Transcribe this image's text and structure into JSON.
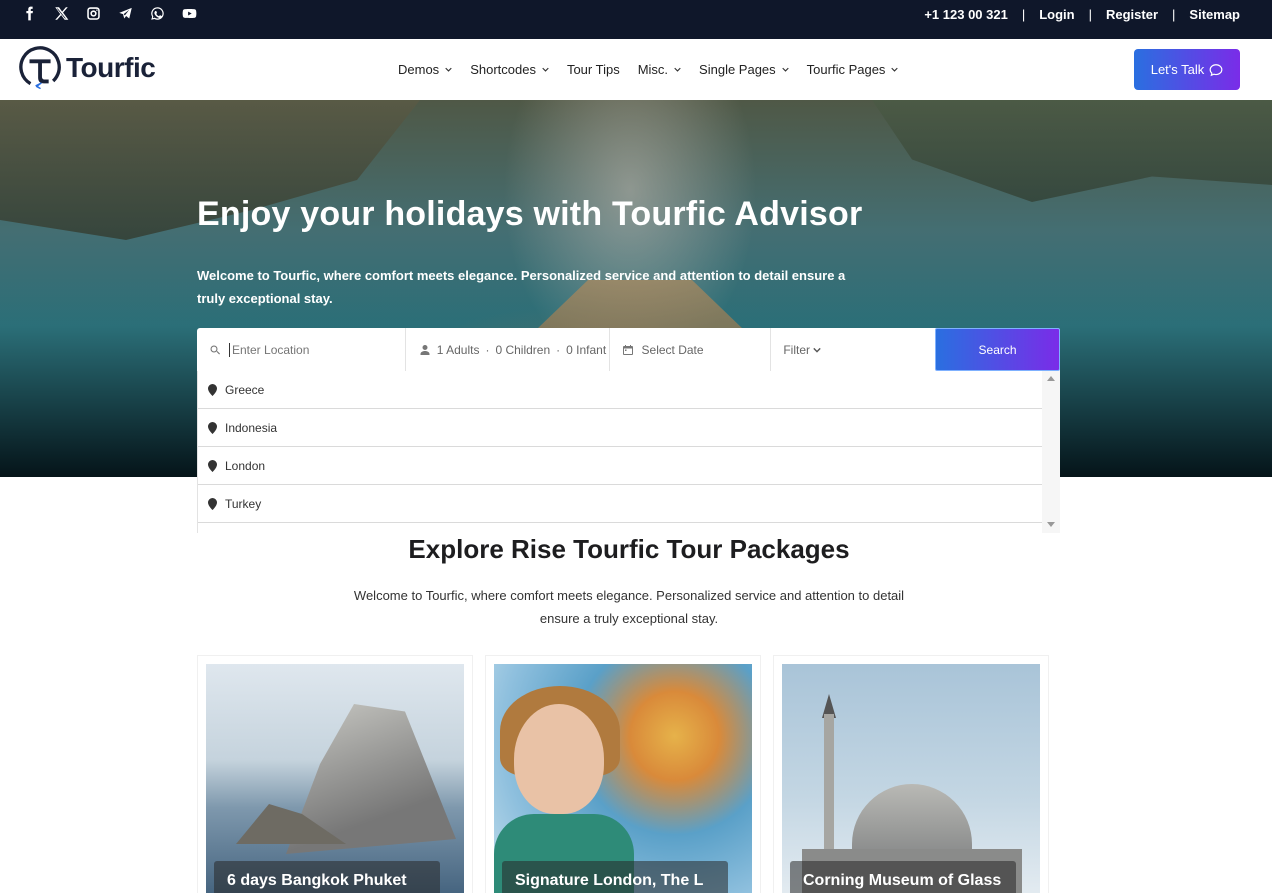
{
  "topbar": {
    "social_icons": [
      "facebook-icon",
      "x-icon",
      "instagram-icon",
      "telegram-icon",
      "whatsapp-icon",
      "youtube-icon"
    ],
    "phone": "+1 123  00 321",
    "login": "Login",
    "register": "Register",
    "sitemap": "Sitemap",
    "separator": "|"
  },
  "header": {
    "logo_text": "Tourfic",
    "nav": [
      {
        "label": "Demos",
        "dropdown": true
      },
      {
        "label": "Shortcodes",
        "dropdown": true
      },
      {
        "label": "Tour Tips",
        "dropdown": false
      },
      {
        "label": "Misc.",
        "dropdown": true
      },
      {
        "label": "Single Pages",
        "dropdown": true
      },
      {
        "label": "Tourfic Pages",
        "dropdown": true
      }
    ],
    "cta": "Let's Talk"
  },
  "hero": {
    "title": "Enjoy your holidays with Tourfic Advisor",
    "subtitle": "Welcome to Tourfic, where comfort meets elegance. Personalized service and attention to detail ensure a truly exceptional stay."
  },
  "search": {
    "location_placeholder": "Enter Location",
    "adults": "1 Adults",
    "children": "0 Children",
    "infant": "0 Infant",
    "dot": "·",
    "date_placeholder": "Select Date",
    "filter": "Filter",
    "button": "Search",
    "suggestions": [
      "Greece",
      "Indonesia",
      "London",
      "Turkey"
    ]
  },
  "section": {
    "title": "Explore Rise Tourfic Tour Packages",
    "subtitle": "Welcome to Tourfic, where comfort meets elegance. Personalized service and attention to detail ensure a truly exceptional stay."
  },
  "cards": [
    {
      "title": "6 days Bangkok Phuket"
    },
    {
      "title": "Signature London, The L"
    },
    {
      "title": "Corning Museum of Glass"
    }
  ],
  "colors": {
    "topbar": "#0f172a",
    "accent_start": "#2a6fe0",
    "accent_end": "#7a2ce8"
  }
}
